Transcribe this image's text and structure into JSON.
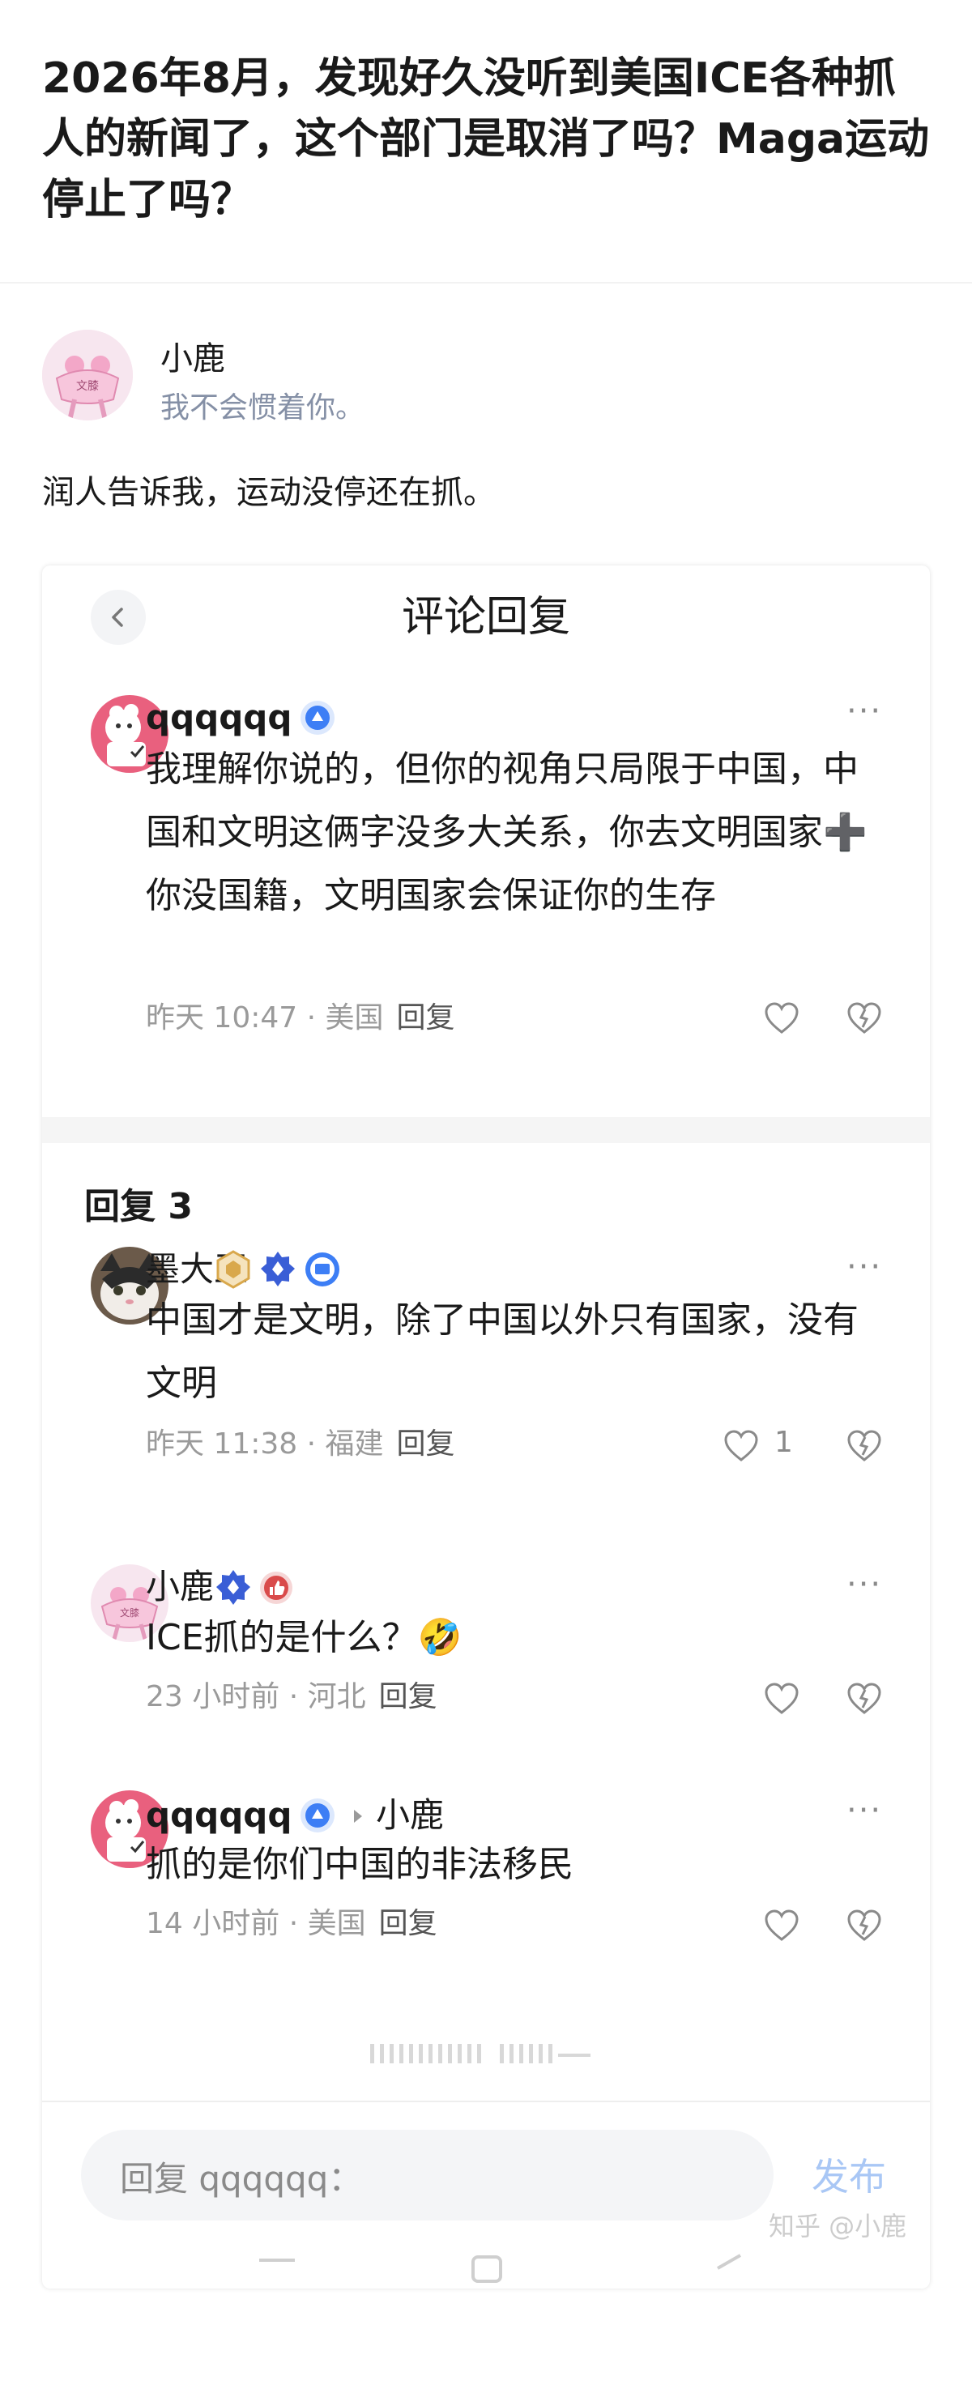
{
  "question": {
    "title": "2026年8月，发现好久没听到美国ICE各种抓人的新闻了，这个部门是取消了吗？Maga运动停止了吗？"
  },
  "answer": {
    "author_name": "小鹿",
    "author_bio": "我不会惯着你。",
    "avatar_text": "文膝",
    "text": "润人告诉我，运动没停还在抓。"
  },
  "panel": {
    "title": "评论回复",
    "main_comment": {
      "user": "qqqqqq",
      "text": "我理解你说的，但你的视角只局限于中国，中国和文明这俩字没多大关系，你去文明国家➕你没国籍，文明国家会保证你的生存",
      "meta": "昨天 10:47 · 美国",
      "reply_label": "回复"
    },
    "reply_count_label": "回复 3",
    "replies": [
      {
        "user": "墨大王",
        "text": "中国才是文明，除了中国以外只有国家，没有文明",
        "meta": "昨天 11:38 · 福建",
        "reply_label": "回复",
        "likes": "1"
      },
      {
        "user": "小鹿",
        "text": "ICE抓的是什么？🤣",
        "meta": "23 小时前 · 河北",
        "reply_label": "回复"
      },
      {
        "user": "qqqqqq",
        "reply_to": "小鹿",
        "text": "抓的是你们中国的非法移民",
        "meta": "14 小时前 · 美国",
        "reply_label": "回复"
      }
    ],
    "input_placeholder": "回复 qqqqqq：",
    "send_label": "发布",
    "watermark": "知乎 @小鹿",
    "more_label": "···"
  },
  "colors": {
    "accent_blue": "#3d7ef5",
    "send_disabled": "#a9c7f5",
    "meta_gray": "#9a9a9a"
  }
}
